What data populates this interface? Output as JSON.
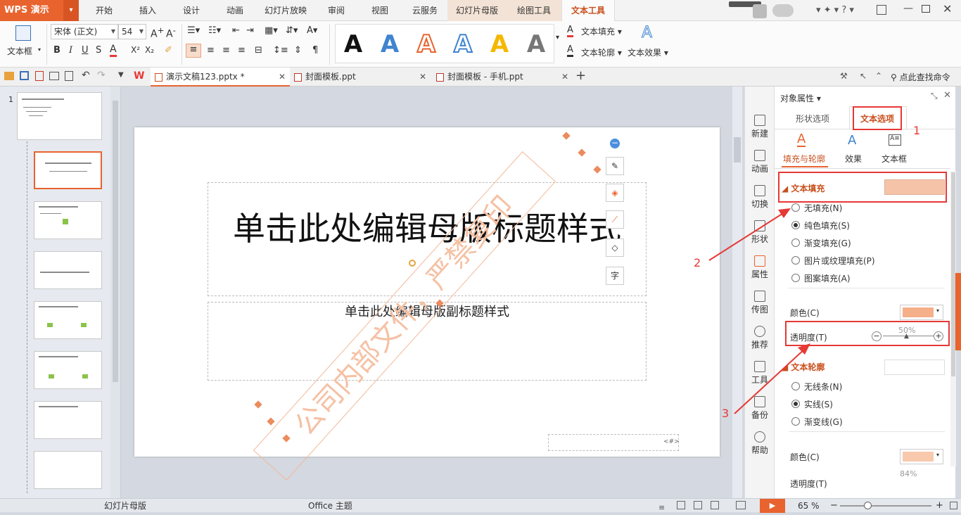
{
  "app": {
    "name": "WPS 演示",
    "dd": "▾"
  },
  "ribbon_tabs": [
    "开始",
    "插入",
    "设计",
    "动画",
    "幻灯片放映",
    "审阅",
    "视图",
    "云服务",
    "幻灯片母版",
    "绘图工具",
    "文本工具"
  ],
  "ribbon": {
    "textbox_label": "文本框",
    "font_name": "宋体 (正文)",
    "font_size": "54",
    "text_fill": "文本填充",
    "text_outline": "文本轮廓",
    "text_effect": "文本效果",
    "style_letter": "A"
  },
  "doc_tabs": [
    {
      "label": "演示文稿123.pptx *"
    },
    {
      "label": "封面模板.ppt"
    },
    {
      "label": "封面模板 - 手机.ppt"
    }
  ],
  "find_cmd": "点此查找命令",
  "slide": {
    "title": "单击此处编辑母版标题样式",
    "subtitle": "单击此处编辑母版副标题样式",
    "watermark": "公司内部文件，严禁复印",
    "page_num": "<#>"
  },
  "thumbs": {
    "first_num": "1"
  },
  "side_tools": [
    "新建",
    "动画",
    "切换",
    "形状",
    "属性",
    "传图",
    "推荐",
    "工具",
    "备份",
    "帮助"
  ],
  "pane": {
    "title": "对象属性",
    "tabs": [
      "形状选项",
      "文本选项"
    ],
    "subtabs": [
      "填充与轮廓",
      "效果",
      "文本框"
    ],
    "fill_section": "文本填充",
    "fill_options": [
      "无填充(N)",
      "纯色填充(S)",
      "渐变填充(G)",
      "图片或纹理填充(P)",
      "图案填充(A)"
    ],
    "color_label": "颜色(C)",
    "transparency_label": "透明度(T)",
    "transparency_value": "50%",
    "outline_section": "文本轮廓",
    "outline_options": [
      "无线条(N)",
      "实线(S)",
      "渐变线(G)"
    ],
    "color_label2": "颜色(C)",
    "transparency_value2": "84%",
    "transparency_label2": "透明度(T)"
  },
  "annotations": [
    "1",
    "2",
    "3"
  ],
  "status": {
    "mode": "幻灯片母版",
    "theme": "Office 主题",
    "zoom": "65 %"
  },
  "colors": {
    "accent": "#e8632e",
    "fill": "#f5c4a8",
    "red": "#e53935"
  }
}
